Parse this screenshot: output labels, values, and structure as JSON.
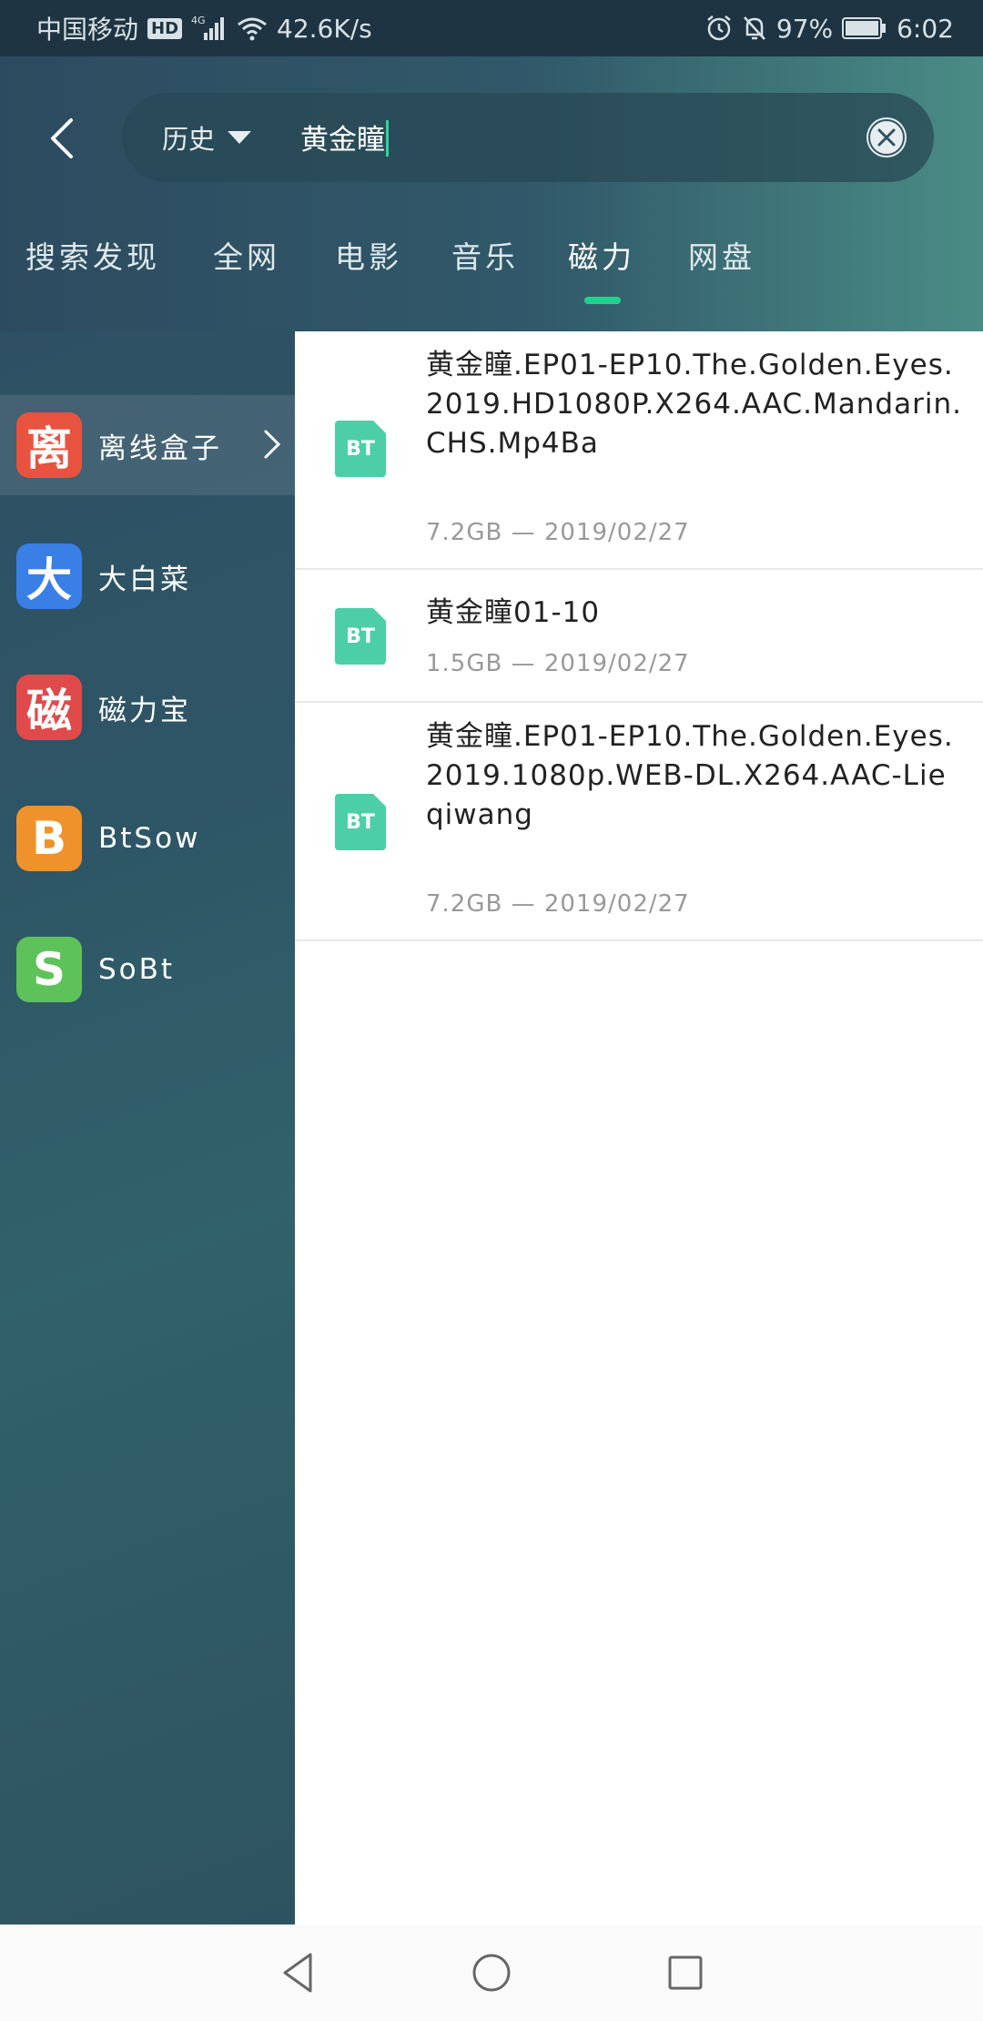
{
  "statusbar": {
    "carrier": "中国移动",
    "hd": "HD",
    "network": "4G",
    "speed": "42.6K/s",
    "battery": "97%",
    "time": "6:02"
  },
  "search": {
    "history_label": "历史",
    "query": "黄金瞳"
  },
  "tabs": [
    {
      "label": "搜索发现"
    },
    {
      "label": "全网"
    },
    {
      "label": "电影"
    },
    {
      "label": "音乐"
    },
    {
      "label": "磁力",
      "active": true
    },
    {
      "label": "网盘"
    }
  ],
  "sidebar": {
    "items": [
      {
        "icon_char": "离",
        "icon_color": "#e8533f",
        "label": "离线盒子",
        "active": true
      },
      {
        "icon_char": "大",
        "icon_color": "#3a7fe6",
        "label": "大白菜"
      },
      {
        "icon_char": "磁",
        "icon_color": "#e04a4a",
        "label": "磁力宝"
      },
      {
        "icon_char": "B",
        "icon_color": "#f0922b",
        "label": "BtSow"
      },
      {
        "icon_char": "S",
        "icon_color": "#5ec25a",
        "label": "SoBt"
      }
    ]
  },
  "results": [
    {
      "icon_label": "BT",
      "title": "黄金瞳.EP01-EP10.The.Golden.Eyes.2019.HD1080P.X264.AAC.Mandarin.CHS.Mp4Ba",
      "meta": "7.2GB — 2019/02/27"
    },
    {
      "icon_label": "BT",
      "title": "黄金瞳01-10",
      "meta": "1.5GB — 2019/02/27"
    },
    {
      "icon_label": "BT",
      "title": "黄金瞳.EP01-EP10.The.Golden.Eyes.2019.1080p.WEB-DL.X264.AAC-Lieqiwang",
      "meta": "7.2GB — 2019/02/27"
    }
  ],
  "colors": {
    "accent": "#20d28e",
    "bt_icon": "#4ccfa6"
  }
}
